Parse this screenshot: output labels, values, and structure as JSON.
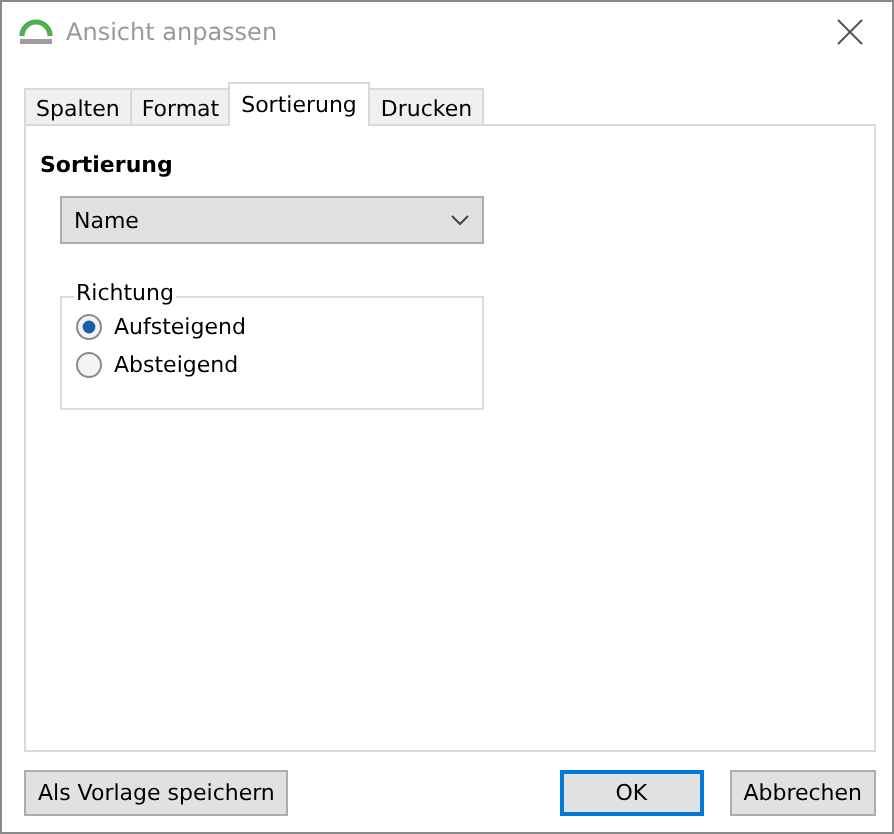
{
  "window": {
    "title": "Ansicht anpassen"
  },
  "tabs": [
    {
      "label": "Spalten",
      "selected": false
    },
    {
      "label": "Format",
      "selected": false
    },
    {
      "label": "Sortierung",
      "selected": true
    },
    {
      "label": "Drucken",
      "selected": false
    }
  ],
  "section_title": "Sortierung",
  "sort_dropdown": {
    "value": "Name"
  },
  "direction_group": {
    "title": "Richtung",
    "options": [
      {
        "label": "Aufsteigend",
        "selected": true
      },
      {
        "label": "Absteigend",
        "selected": false
      }
    ]
  },
  "buttons": [
    {
      "label": "Als Vorlage speichern",
      "kind": "secondary"
    },
    {
      "label": "OK",
      "kind": "default"
    },
    {
      "label": "Abbrechen",
      "kind": "secondary"
    }
  ]
}
